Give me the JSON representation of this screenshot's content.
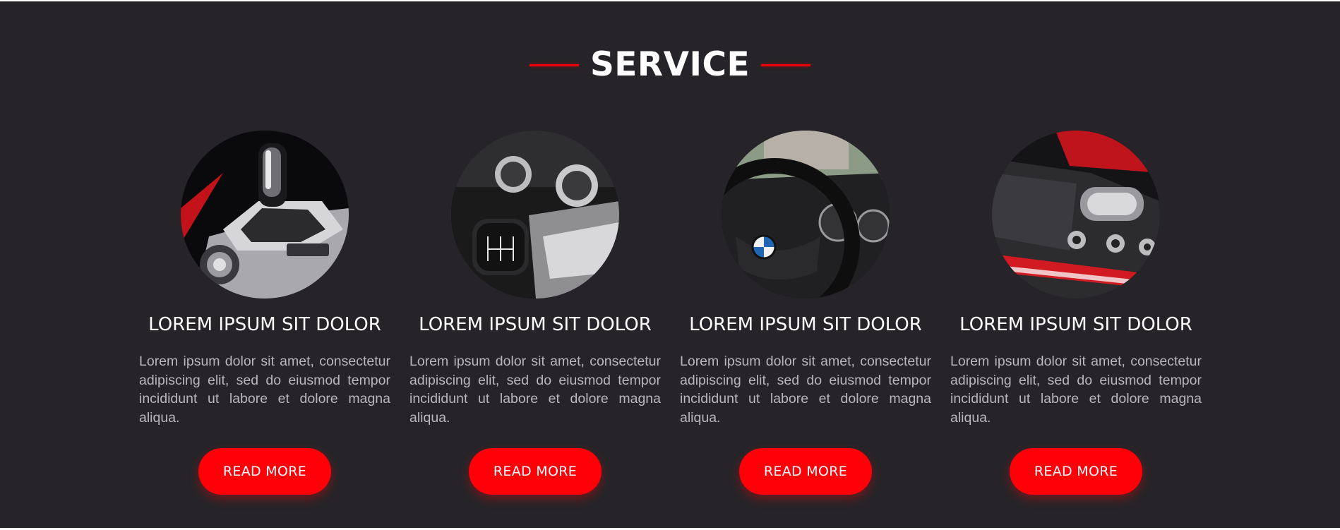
{
  "section": {
    "title": "SERVICE",
    "accent_color": "#ff0008",
    "background_color": "#262428"
  },
  "cards": [
    {
      "image_icon": "gear-shifter-icon",
      "title": "LOREM IPSUM SIT DOLOR",
      "text": "Lorem ipsum dolor sit amet, consectetur adipiscing elit, sed do eiusmod tempor incididunt ut labore et dolore magna aliqua.",
      "button_label": "READ MORE"
    },
    {
      "image_icon": "manual-shift-knob-icon",
      "title": "LOREM IPSUM SIT DOLOR",
      "text": "Lorem ipsum dolor sit amet, consectetur adipiscing elit, sed do eiusmod tempor incididunt ut labore et dolore magna aliqua.",
      "button_label": "READ MORE"
    },
    {
      "image_icon": "steering-wheel-icon",
      "title": "LOREM IPSUM SIT DOLOR",
      "text": "Lorem ipsum dolor sit amet, consectetur adipiscing elit, sed do eiusmod tempor incididunt ut labore et dolore magna aliqua.",
      "button_label": "READ MORE"
    },
    {
      "image_icon": "center-console-icon",
      "title": "LOREM IPSUM SIT DOLOR",
      "text": "Lorem ipsum dolor sit amet, consectetur adipiscing elit, sed do eiusmod tempor incididunt ut labore et dolore magna aliqua.",
      "button_label": "READ MORE"
    }
  ]
}
